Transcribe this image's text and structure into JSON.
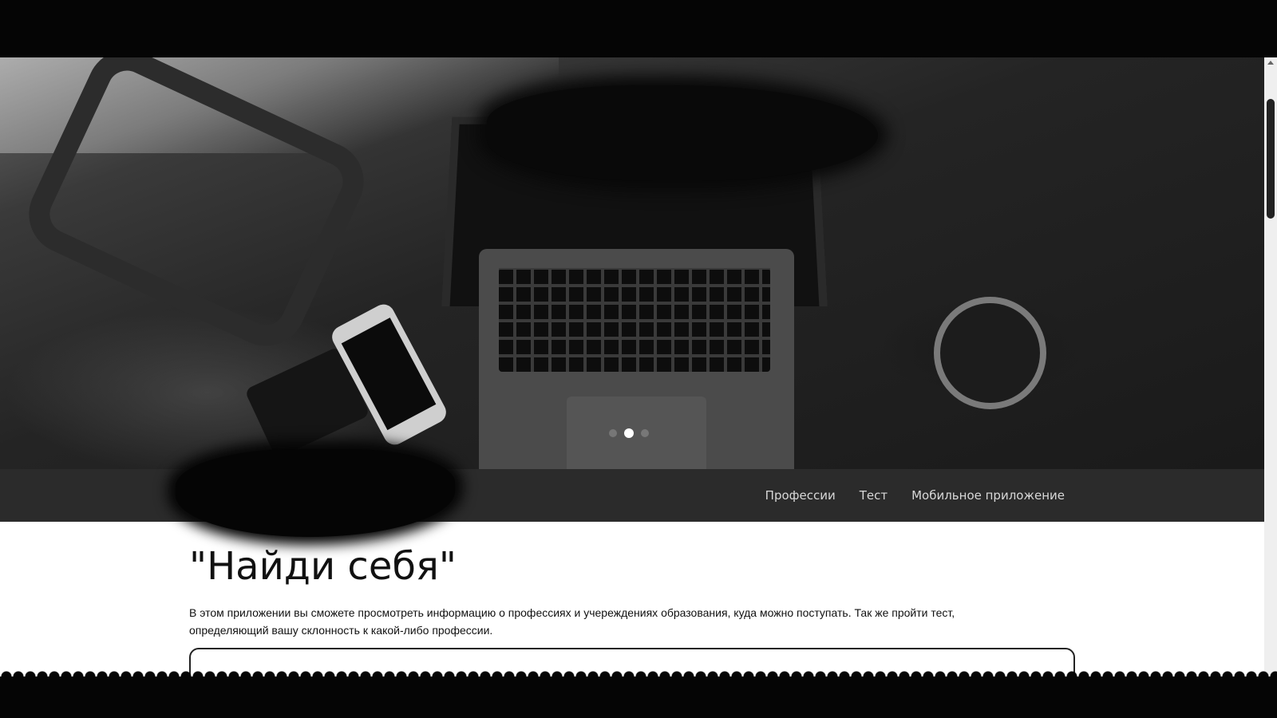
{
  "hero": {
    "caption_title": "",
    "caption_subtitle": "",
    "active_slide": 2,
    "slide_count": 3
  },
  "navbar": {
    "brand": "",
    "links": [
      {
        "label": "Профессии"
      },
      {
        "label": "Тест"
      },
      {
        "label": "Мобильное приложение"
      }
    ]
  },
  "main": {
    "heading": "\"Найди себя\"",
    "intro": "В этом приложении вы сможете просмотреть информацию о профессиях и учереждениях образования, куда можно поступать. Так же пройти тест, определяющий вашу склонность к какой-либо профессии.",
    "card_heading": ""
  }
}
